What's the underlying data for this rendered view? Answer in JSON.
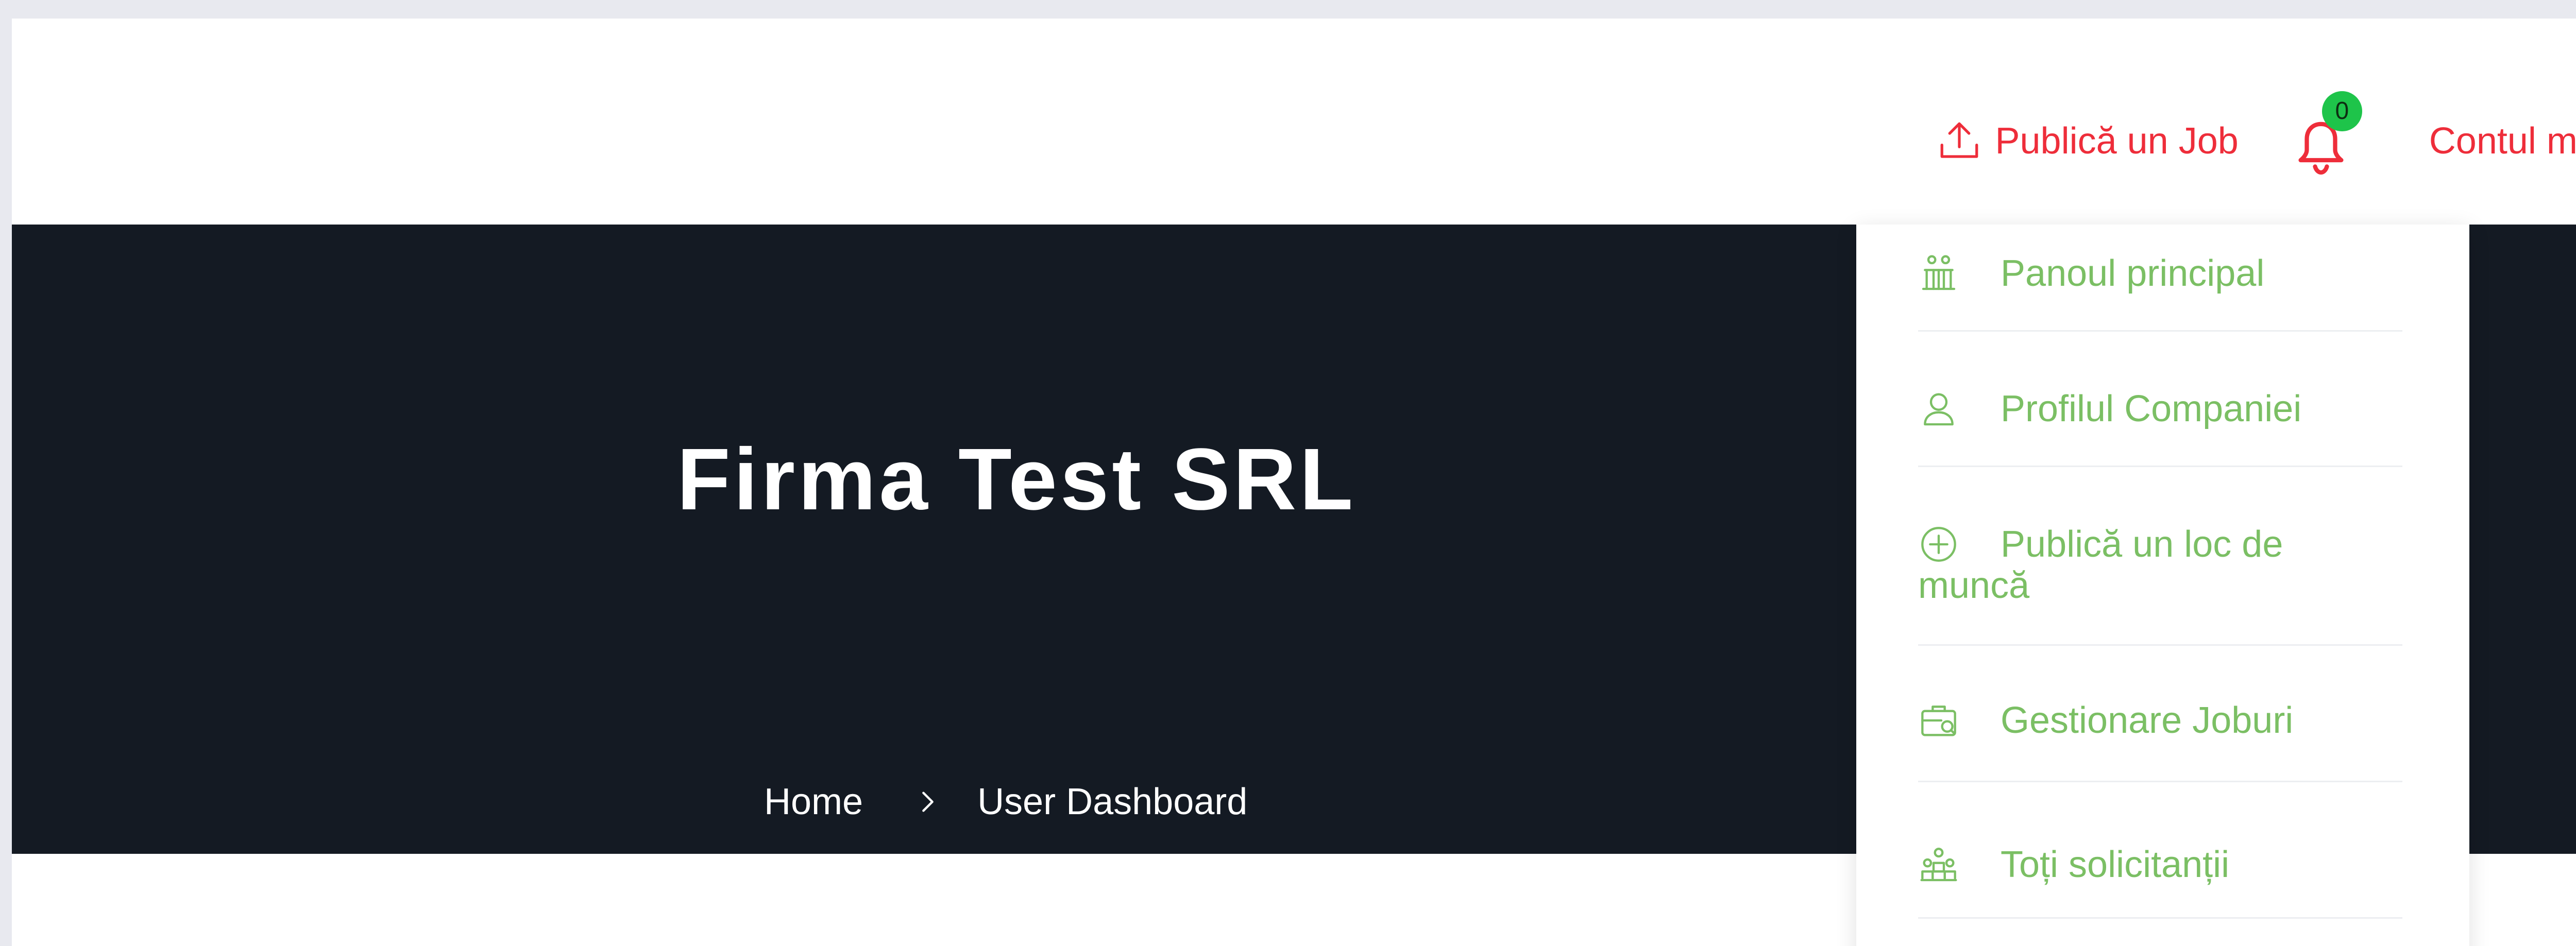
{
  "nav": {
    "post_job": "Publică un Job",
    "notifications_count": "0",
    "account": "Contul meu"
  },
  "hero": {
    "title": "Firma Test SRL",
    "breadcrumb": [
      "Home",
      "User Dashboard"
    ]
  },
  "menu": {
    "items": [
      {
        "label": "Panoul principal",
        "icon": "dashboard-icon"
      },
      {
        "label": "Profilul Companiei",
        "icon": "user-icon"
      },
      {
        "label_line1": "Publică un loc de",
        "label_line2": "muncă",
        "icon": "plus-circle-icon"
      },
      {
        "label": "Gestionare Joburi",
        "icon": "briefcase-icon"
      },
      {
        "label": "Toți solicitanții",
        "icon": "group-icon"
      }
    ]
  },
  "colors": {
    "accent_red": "#ee2d3a",
    "menu_green": "#7bbf64",
    "hero_bg": "#141a23",
    "badge_green": "#1ec44a"
  }
}
